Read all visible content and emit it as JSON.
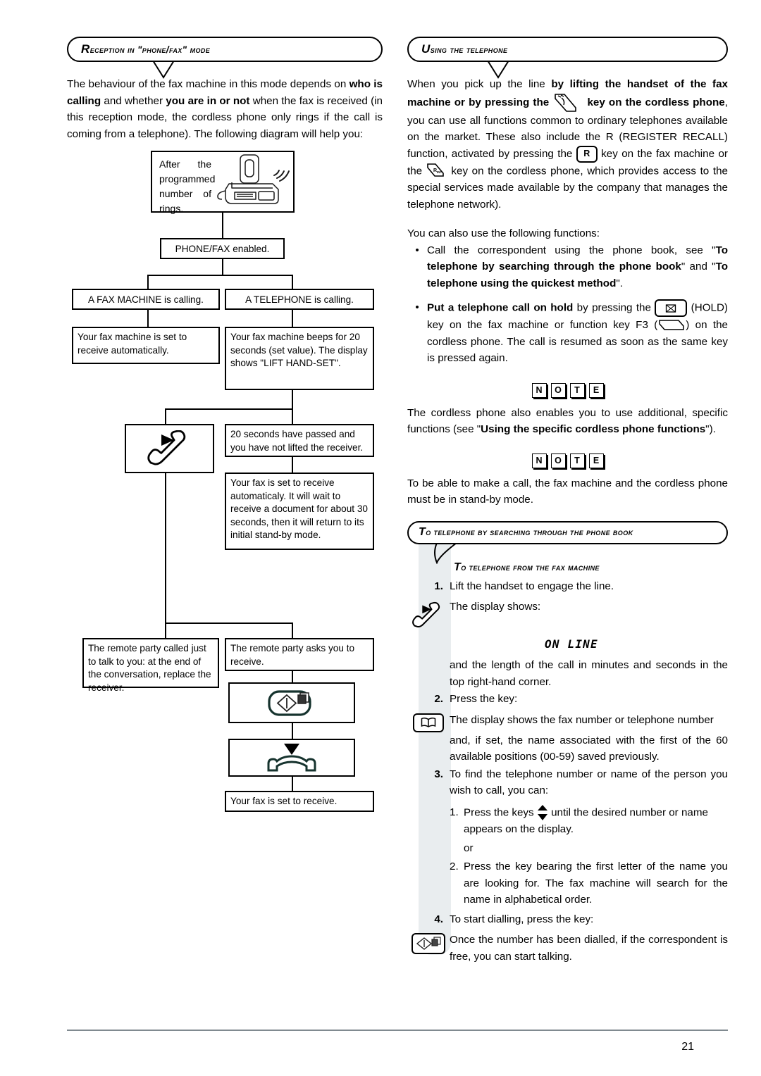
{
  "page": {
    "number": "21"
  },
  "left": {
    "header": {
      "cap": "R",
      "rest": "eception in \"phone/fax\" mode"
    },
    "intro": {
      "p1a": "The behaviour of the fax machine in this mode depends on ",
      "b1": "who is calling",
      "p1b": " and whether ",
      "b2": "you are in or not",
      "p1c": " when the fax is received (in this reception mode, the cordless phone only rings if the call is coming from a telephone). The following diagram will help you:"
    },
    "flow": {
      "machine_text": "After the programmed number of rings.",
      "machine_icon": "fax-machine-ringing-icon",
      "phonefax": "PHONE/FAX enabled.",
      "fax_calling": "A FAX MACHINE is calling.",
      "tel_calling": "A TELEPHONE is calling.",
      "fax_auto": "Your fax machine is set to receive automatically.",
      "beeps": "Your fax machine beeps for 20 seconds (set value). The display shows \"LIFT HAND-SET\".",
      "lift_handset_icon": "lift-handset-icon",
      "passed": "20 seconds have passed and you have not lifted the receiver.",
      "auto_receive": "Your fax is set to receive automaticaly. It will wait to receive a document for about 30 seconds, then it will return to its initial stand-by mode.",
      "remote_talk": "The remote party called just to talk to you: at the end of the conversation, replace the receiver.",
      "remote_receive": "The remote party asks you to receive.",
      "start_key_icon": "start-copy-key-icon",
      "hangup_icon": "hang-up-handset-icon",
      "set_receive": "Your fax is set to receive."
    }
  },
  "right": {
    "header": {
      "cap": "U",
      "rest": "sing the telephone"
    },
    "intro": {
      "a1": "When you pick up the line ",
      "b1": "by lifting the handset of the fax machine or by pressing the",
      "icon1": "cordless-talk-key-icon",
      "b2": "key on the cordless phone",
      "a2": ", you can use all functions common to ordinary telephones available on the market.",
      "a3": "These also include the R (REGISTER RECALL) function, activated by pressing the",
      "key_r": "R",
      "a4": "key on the fax machine or the",
      "icon2": "cordless-r-key-icon",
      "a5": "key on the cordless phone, which provides access to the special services made available by the company that manages the telephone network)."
    },
    "functions_intro": "You can also use the following functions:",
    "bullets": [
      {
        "bullet": "•",
        "pre": "Call the correspondent using the phone book, see \"",
        "bold1": "To telephone by searching through the phone book",
        "mid": "\" and \"",
        "bold2": "To telephone using the quickest method",
        "post": "\"."
      }
    ],
    "hold": {
      "bullet": "•",
      "bold": "Put a telephone call on hold",
      "mid": " by pressing the",
      "key_hold_icon": "hold-key-icon",
      "rest1": "(HOLD) key on the fax machine or function key F3 (",
      "f3_icon": "f3-soft-key-icon",
      "rest2": ") on the cordless phone. The call is resumed as soon as the same key is pressed again."
    },
    "note_letters": [
      "N",
      "O",
      "T",
      "E"
    ],
    "note1": {
      "a": "The cordless phone also enables you to use additional, specific functions (see \"",
      "b": "Using the specific cordless phone functions",
      "c": "\")."
    },
    "note2": "To be able to make a call, the fax machine and the cordless phone must be in stand-by mode.",
    "pb_header": {
      "cap": "T",
      "rest": "o telephone by searching through the phone book"
    },
    "pb_sub": {
      "cap": "T",
      "rest": "o telephone from the fax machine"
    },
    "steps": {
      "s1_num": "1.",
      "s1": "Lift the handset to engage the line.",
      "lift_icon": "lift-handset-icon",
      "display_shows": "The display shows:",
      "online": "ON LINE",
      "after_online": "and the length of the call in minutes and seconds in the top right-hand corner.",
      "s2_num": "2.",
      "s2": "Press the key:",
      "book_icon": "phone-book-key-icon",
      "s2_body1": "The display shows the fax number or telephone number",
      "s2_body2": "and, if set, the name associated with the first of the 60 available positions (00-59) saved previously.",
      "s3_num": "3.",
      "s3": "To find the telephone number or name of the person you wish to call, you can:",
      "s3a_num": "1.",
      "s3a_pre": "Press the keys",
      "arrows_icon": "up-down-arrows-icon",
      "s3a_post": "until the desired number or name appears on the display.",
      "or": "or",
      "s3b_num": "2.",
      "s3b": "Press the key bearing the first letter of the name you are looking for. The fax machine will search for the name in alphabetical order.",
      "s4_num": "4.",
      "s4": "To start dialling, press the key:",
      "start_icon": "start-dial-key-icon",
      "s4_body": "Once the number has been dialled, if the correspondent is free, you can start talking."
    }
  }
}
